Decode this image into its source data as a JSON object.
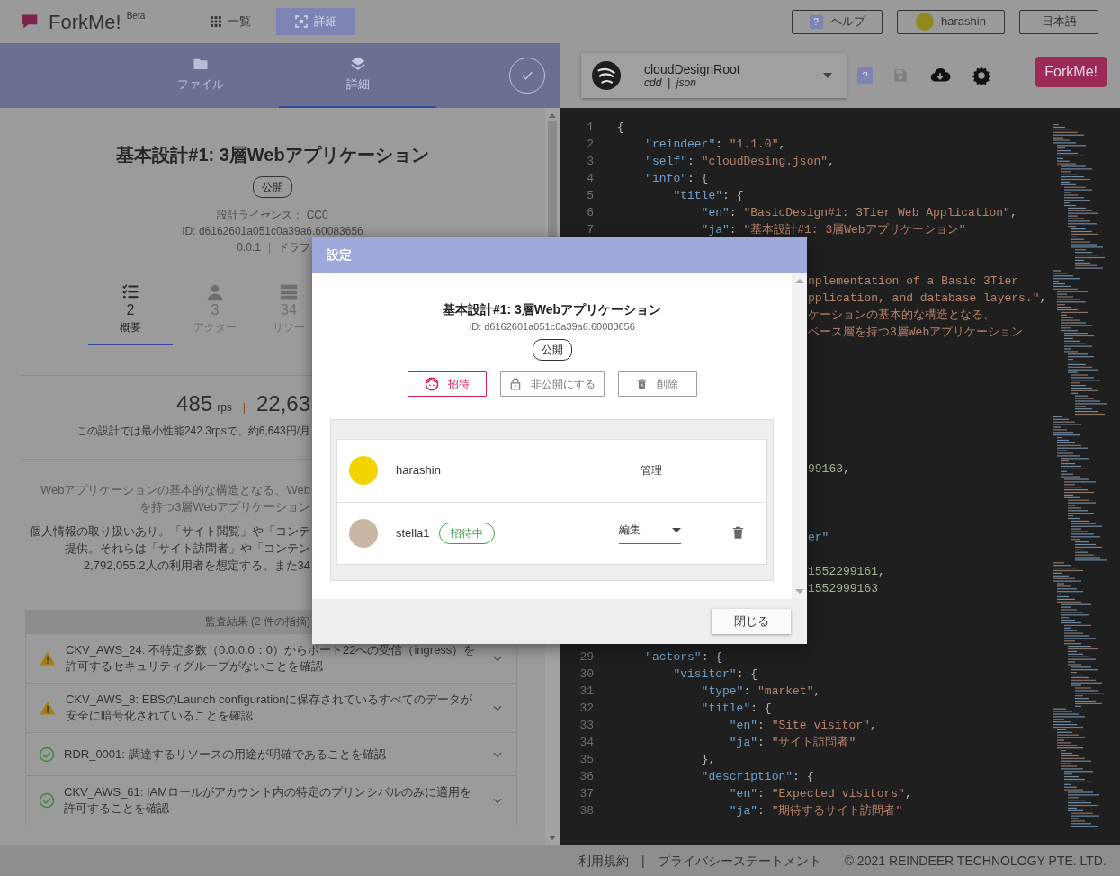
{
  "header": {
    "logo": "ForkMe!",
    "beta": "Beta",
    "nav": [
      {
        "label": "一覧",
        "selected": false
      },
      {
        "label": "詳細",
        "selected": true
      }
    ],
    "buttons": [
      {
        "kind": "help",
        "icon_text": "?",
        "label": "ヘルプ"
      },
      {
        "kind": "user",
        "label": "harashin"
      },
      {
        "kind": "plain",
        "label": "日本語"
      }
    ]
  },
  "left_panel": {
    "tabs": [
      {
        "label": "ファイル",
        "selected": false
      },
      {
        "label": "詳細",
        "selected": true
      }
    ],
    "title": "基本設計#1: 3層Webアプリケーション",
    "visibility": "公開",
    "license": "設計ライセンス： CC0",
    "id": "ID: d6162601a051c0a39a6.60083656",
    "version": "0.0.1",
    "version_separator": "|",
    "status": "ドラフ",
    "stats": [
      {
        "count": "2",
        "label": "概要",
        "selected": true
      },
      {
        "count": "3",
        "label": "アクター",
        "selected": false
      },
      {
        "count": "34",
        "label": "リソー",
        "selected": false
      }
    ],
    "performance": {
      "value": "485",
      "unit": "rps",
      "separator": "|",
      "second_value": "22,63",
      "summary": "この設計では最小性能242.3rpsで、約6,643円/月"
    },
    "description_lines": [
      {
        "kind": "summary",
        "text": "Webアプリケーションの基本的な構造となる、Web"
      },
      {
        "kind": "summary",
        "text": "を持つ3層Webアプリケーション"
      },
      {
        "kind": "detail",
        "text": "個人情報の取り扱いあり。「サイト閲覧」や「コンテ"
      },
      {
        "kind": "detail",
        "text": "提供。それらは「サイト訪問者」や「コンテン"
      },
      {
        "kind": "detail",
        "text": "2,792,055.2人の利用者を想定する。また34"
      }
    ],
    "audit": {
      "header": "監査結果 (2 件の指摘)",
      "items": [
        {
          "kind": "warning",
          "text": "CKV_AWS_24: 不特定多数（0.0.0.0：0）からポート22への受信（ingress）を許可するセキュリティグループがないことを確認"
        },
        {
          "kind": "warning",
          "text": "CKV_AWS_8: EBSのLaunch configurationに保存されているすべてのデータが安全に暗号化されていることを確認"
        },
        {
          "kind": "pass",
          "text": "RDR_0001: 調達するリソースの用途が明確であることを確認"
        },
        {
          "kind": "pass",
          "text": "CKV_AWS_61: IAMロールがアカウント内の特定のプリンシパルのみに適用を許可することを確認"
        }
      ]
    }
  },
  "editor_toolbar": {
    "project": {
      "name": "cloudDesignRoot",
      "meta": "cdd  |  json"
    },
    "tools": [
      {
        "kind": "help",
        "icon_text": "?",
        "disabled": false
      },
      {
        "kind": "save",
        "disabled": true
      },
      {
        "kind": "download",
        "disabled": false
      },
      {
        "kind": "settings",
        "disabled": false
      }
    ],
    "badge": "ForkMe!"
  },
  "code_lines": [
    {
      "kind": "line",
      "number": "1",
      "segments": [
        {
          "kind": "punct",
          "text": "{"
        }
      ]
    },
    {
      "kind": "line",
      "number": "2",
      "segments": [
        {
          "kind": "key",
          "text": "    \"reindeer\""
        },
        {
          "kind": "punct",
          "text": ": "
        },
        {
          "kind": "string",
          "text": "\"1.1.0\""
        },
        {
          "kind": "punct",
          "text": ","
        }
      ]
    },
    {
      "kind": "line",
      "number": "3",
      "segments": [
        {
          "kind": "key",
          "text": "    \"self\""
        },
        {
          "kind": "punct",
          "text": ": "
        },
        {
          "kind": "string",
          "text": "\"cloudDesing.json\""
        },
        {
          "kind": "punct",
          "text": ","
        }
      ]
    },
    {
      "kind": "line",
      "number": "4",
      "segments": [
        {
          "kind": "key",
          "text": "    \"info\""
        },
        {
          "kind": "punct",
          "text": ": {"
        }
      ]
    },
    {
      "kind": "line",
      "number": "5",
      "segments": [
        {
          "kind": "key",
          "text": "        \"title\""
        },
        {
          "kind": "punct",
          "text": ": {"
        }
      ]
    },
    {
      "kind": "line",
      "number": "6",
      "segments": [
        {
          "kind": "key",
          "text": "            \"en\""
        },
        {
          "kind": "punct",
          "text": ": "
        },
        {
          "kind": "string",
          "text": "\"BasicDesign#1: 3Tier Web Application\""
        },
        {
          "kind": "punct",
          "text": ","
        }
      ]
    },
    {
      "kind": "line",
      "number": "7",
      "segments": [
        {
          "kind": "key",
          "text": "            \"ja\""
        },
        {
          "kind": "punct",
          "text": ": "
        },
        {
          "kind": "string",
          "text": "\"基本設計#1: 3層Webアプリケーション\""
        }
      ]
    },
    {
      "kind": "covered"
    },
    {
      "kind": "covered"
    },
    {
      "kind": "clipped",
      "segments": [
        {
          "kind": "string",
          "text": "nplementation of a Basic 3Tier"
        }
      ]
    },
    {
      "kind": "clipped",
      "segments": [
        {
          "kind": "string",
          "text": "pplication, and database layers.\""
        },
        {
          "kind": "punct",
          "text": ","
        }
      ]
    },
    {
      "kind": "clipped",
      "segments": [
        {
          "kind": "string",
          "text": "ケーションの基本的な構造となる、"
        }
      ]
    },
    {
      "kind": "clipped",
      "segments": [
        {
          "kind": "string",
          "text": "ベース層を持つ3層Webアプリケーション"
        }
      ]
    },
    {
      "kind": "covered"
    },
    {
      "kind": "covered"
    },
    {
      "kind": "covered"
    },
    {
      "kind": "covered"
    },
    {
      "kind": "covered"
    },
    {
      "kind": "covered"
    },
    {
      "kind": "covered"
    },
    {
      "kind": "clipped",
      "segments": [
        {
          "kind": "number",
          "text": "99163"
        },
        {
          "kind": "punct",
          "text": ","
        }
      ]
    },
    {
      "kind": "covered"
    },
    {
      "kind": "covered"
    },
    {
      "kind": "covered"
    },
    {
      "kind": "clipped",
      "segments": [
        {
          "kind": "key",
          "text": "er\""
        }
      ]
    },
    {
      "kind": "covered"
    },
    {
      "kind": "clipped",
      "segments": [
        {
          "kind": "number",
          "text": "1552299161"
        },
        {
          "kind": "punct",
          "text": ","
        }
      ]
    },
    {
      "kind": "clipped",
      "segments": [
        {
          "kind": "number",
          "text": "1552999163"
        }
      ]
    },
    {
      "kind": "covered"
    },
    {
      "kind": "covered"
    },
    {
      "kind": "covered"
    },
    {
      "kind": "line",
      "number": "29",
      "segments": [
        {
          "kind": "key",
          "text": "    \"actors\""
        },
        {
          "kind": "punct",
          "text": ": {"
        }
      ]
    },
    {
      "kind": "line",
      "number": "30",
      "segments": [
        {
          "kind": "key",
          "text": "        \"visitor\""
        },
        {
          "kind": "punct",
          "text": ": {"
        }
      ]
    },
    {
      "kind": "line",
      "number": "31",
      "segments": [
        {
          "kind": "key",
          "text": "            \"type\""
        },
        {
          "kind": "punct",
          "text": ": "
        },
        {
          "kind": "string",
          "text": "\"market\""
        },
        {
          "kind": "punct",
          "text": ","
        }
      ]
    },
    {
      "kind": "line",
      "number": "32",
      "segments": [
        {
          "kind": "key",
          "text": "            \"title\""
        },
        {
          "kind": "punct",
          "text": ": {"
        }
      ]
    },
    {
      "kind": "line",
      "number": "33",
      "segments": [
        {
          "kind": "key",
          "text": "                \"en\""
        },
        {
          "kind": "punct",
          "text": ": "
        },
        {
          "kind": "string",
          "text": "\"Site visitor\""
        },
        {
          "kind": "punct",
          "text": ","
        }
      ]
    },
    {
      "kind": "line",
      "number": "34",
      "segments": [
        {
          "kind": "key",
          "text": "                \"ja\""
        },
        {
          "kind": "punct",
          "text": ": "
        },
        {
          "kind": "string",
          "text": "\"サイト訪問者\""
        }
      ]
    },
    {
      "kind": "line",
      "number": "35",
      "segments": [
        {
          "kind": "punct",
          "text": "            },"
        }
      ]
    },
    {
      "kind": "line",
      "number": "36",
      "segments": [
        {
          "kind": "key",
          "text": "            \"description\""
        },
        {
          "kind": "punct",
          "text": ": {"
        }
      ]
    },
    {
      "kind": "line",
      "number": "37",
      "segments": [
        {
          "kind": "key",
          "text": "                \"en\""
        },
        {
          "kind": "punct",
          "text": ": "
        },
        {
          "kind": "string",
          "text": "\"Expected visitors\""
        },
        {
          "kind": "punct",
          "text": ","
        }
      ]
    },
    {
      "kind": "line",
      "number": "38",
      "segments": [
        {
          "kind": "key",
          "text": "                \"ja\""
        },
        {
          "kind": "punct",
          "text": ": "
        },
        {
          "kind": "string",
          "text": "\"期待するサイト訪問者\""
        }
      ]
    }
  ],
  "footer": {
    "links": [
      "利用規約",
      "プライバシーステートメント"
    ],
    "separator": "|",
    "copyright": "© 2021 REINDEER TECHNOLOGY PTE. LTD."
  },
  "dialog": {
    "title": "設定",
    "design_title": "基本設計#1: 3層Webアプリケーション",
    "id": "ID: d6162601a051c0a39a6.60083656",
    "visibility": "公開",
    "actions": [
      {
        "kind": "accent",
        "label": "招待"
      },
      {
        "kind": "plain",
        "label": "非公開にする"
      },
      {
        "kind": "plain",
        "label": "削除"
      }
    ],
    "members": [
      {
        "kind": "owner",
        "name": "harashin",
        "role": "管理"
      },
      {
        "kind": "invited",
        "name": "stella1",
        "badge": "招待中",
        "role": "編集"
      }
    ],
    "close": "閉じる"
  }
}
